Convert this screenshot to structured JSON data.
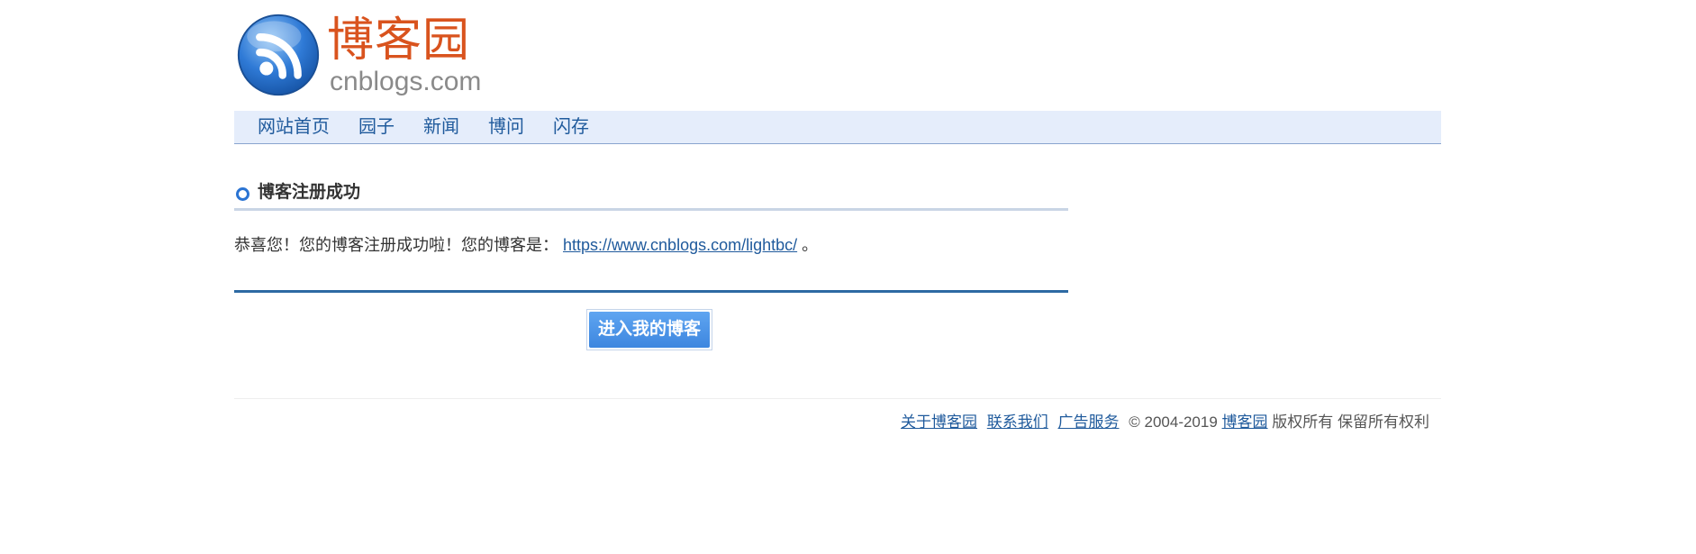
{
  "logo": {
    "cn": "博客园",
    "en": "cnblogs.com"
  },
  "nav": {
    "items": [
      {
        "label": "网站首页"
      },
      {
        "label": "园子"
      },
      {
        "label": "新闻"
      },
      {
        "label": "博问"
      },
      {
        "label": "闪存"
      }
    ]
  },
  "section": {
    "title": "博客注册成功"
  },
  "message": {
    "prefix": "恭喜您！您的博客注册成功啦！您的博客是：",
    "link": "https://www.cnblogs.com/lightbc/",
    "suffix": " 。"
  },
  "button": {
    "label": "进入我的博客"
  },
  "footer": {
    "about": "关于博客园",
    "contact": "联系我们",
    "ads": "广告服务",
    "copyright": "© 2004-2019",
    "site": "博客园",
    "rights": "版权所有 保留所有权利"
  },
  "colors": {
    "brand_orange": "#d9531e",
    "link_blue": "#1f5a9c",
    "nav_bg": "#e5edfb",
    "button_blue": "#4b94e6"
  }
}
